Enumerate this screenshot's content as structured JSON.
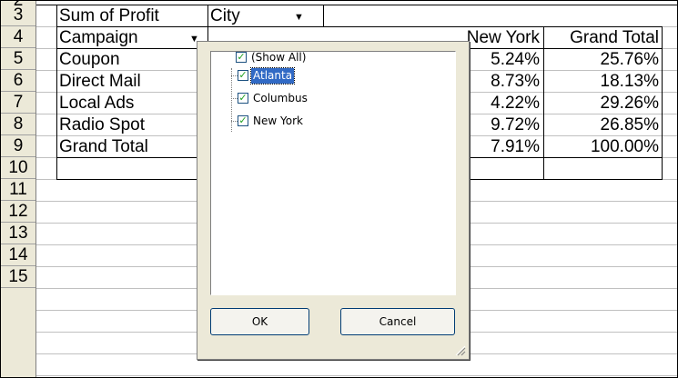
{
  "row_headers": [
    "2",
    "3",
    "4",
    "5",
    "6",
    "7",
    "8",
    "9",
    "10",
    "11",
    "12",
    "13",
    "14",
    "15"
  ],
  "pivot": {
    "data_label": "Sum of Profit",
    "column_field": "City",
    "row_field": "Campaign",
    "column_headers": [
      "New York",
      "Grand Total"
    ],
    "rows": [
      {
        "label": "Coupon",
        "new_york": "5.24%",
        "grand_total": "25.76%"
      },
      {
        "label": "Direct Mail",
        "new_york": "8.73%",
        "grand_total": "18.13%"
      },
      {
        "label": "Local Ads",
        "new_york": "4.22%",
        "grand_total": "29.26%"
      },
      {
        "label": "Radio Spot",
        "new_york": "9.72%",
        "grand_total": "26.85%"
      }
    ],
    "total": {
      "label": "Grand Total",
      "new_york": "7.91%",
      "grand_total": "100.00%"
    }
  },
  "filter_popup": {
    "items": [
      {
        "label": "(Show All)",
        "checked": true
      },
      {
        "label": "Atlanta",
        "checked": true,
        "selected": true
      },
      {
        "label": "Columbus",
        "checked": true
      },
      {
        "label": "New York",
        "checked": true
      }
    ],
    "ok_label": "OK",
    "cancel_label": "Cancel"
  },
  "icons": {
    "dropdown": "dropdown-arrow-icon",
    "check": "checkmark-icon",
    "grip": "resize-grip-icon"
  },
  "colors": {
    "selection": "#316ac5",
    "dialog_bg": "#ece9d8",
    "check": "#21a121"
  }
}
